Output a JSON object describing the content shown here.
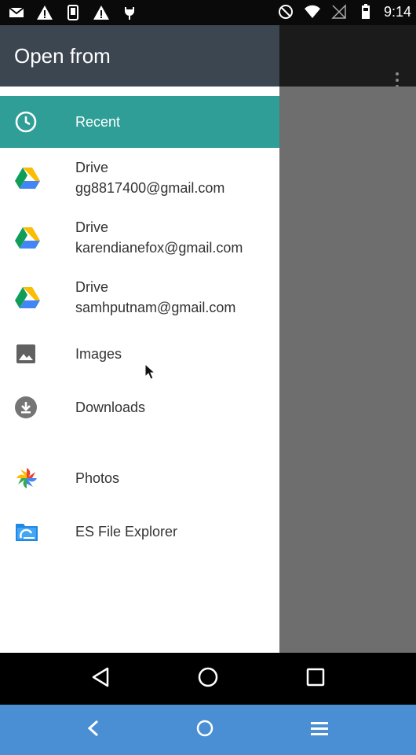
{
  "status_bar": {
    "time": "9:14",
    "left_icons": [
      "gmail-icon",
      "warning-icon",
      "phone-icon",
      "warning-icon",
      "android-debug-icon"
    ],
    "right_icons": [
      "do-not-disturb-icon",
      "wifi-icon",
      "no-signal-icon",
      "battery-icon"
    ]
  },
  "drawer": {
    "title": "Open from",
    "items": [
      {
        "label": "Recent",
        "icon": "clock-icon",
        "selected": true
      },
      {
        "label": "Drive",
        "sublabel": "gg8817400@gmail.com",
        "icon": "google-drive-icon"
      },
      {
        "label": "Drive",
        "sublabel": "karendianefox@gmail.com",
        "icon": "google-drive-icon"
      },
      {
        "label": "Drive",
        "sublabel": "samhputnam@gmail.com",
        "icon": "google-drive-icon"
      },
      {
        "label": "Images",
        "icon": "image-icon"
      },
      {
        "label": "Downloads",
        "icon": "download-icon"
      }
    ],
    "apps": [
      {
        "label": "Photos",
        "icon": "google-photos-icon"
      },
      {
        "label": "ES File Explorer",
        "icon": "es-file-explorer-icon"
      }
    ]
  },
  "colors": {
    "accent": "#2e9e97",
    "header": "#3c4650",
    "browser_bar": "#4a8fd4"
  }
}
